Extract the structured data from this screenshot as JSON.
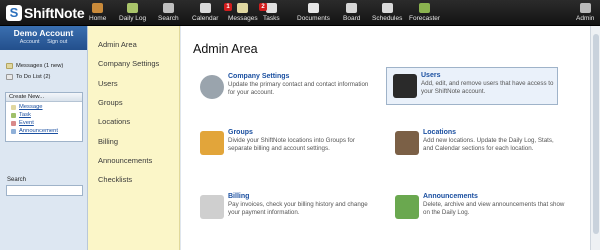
{
  "app": {
    "logo_text": "ShiftNote"
  },
  "topnav": [
    {
      "label": "Home",
      "icon": "home-icon",
      "color": "#c98a3a"
    },
    {
      "label": "Daily Log",
      "icon": "book-icon",
      "color": "#a9c46a"
    },
    {
      "label": "Search",
      "icon": "magnifier-icon",
      "color": "#bfbfbf"
    },
    {
      "label": "Calendar",
      "icon": "calendar-icon",
      "color": "#d9d9d9"
    },
    {
      "label": "Messages",
      "icon": "envelope-icon",
      "color": "#e0d7a0",
      "badge": "1"
    },
    {
      "label": "Tasks",
      "icon": "checklist-icon",
      "color": "#e0e0e0",
      "badge": "2"
    },
    {
      "label": "Documents",
      "icon": "folder-icon",
      "color": "#e6e6e6"
    },
    {
      "label": "Board",
      "icon": "board-icon",
      "color": "#d6d6d6"
    },
    {
      "label": "Schedules",
      "icon": "schedule-icon",
      "color": "#d9d9d9"
    },
    {
      "label": "Forecaster",
      "icon": "chart-icon",
      "color": "#8bb34f"
    },
    {
      "label": "Admin",
      "icon": "admin-icon",
      "color": "#b9b9b9"
    }
  ],
  "account": {
    "name": "Demo Account",
    "account_link": "Account",
    "signout_link": "Sign out"
  },
  "sidebar": {
    "messages": "Messages (1 new)",
    "todo": "To Do List (2)",
    "create_header": "Create New...",
    "create_items": [
      "Message",
      "Task",
      "Event",
      "Announcement"
    ],
    "search_label": "Search"
  },
  "settings_nav": [
    "Admin Area",
    "Company Settings",
    "Users",
    "Groups",
    "Locations",
    "Billing",
    "Announcements",
    "Checklists"
  ],
  "main": {
    "title": "Admin Area",
    "tiles": [
      {
        "title": "Company Settings",
        "desc": "Update the primary contact and contact information for your account.",
        "icon": "gear-icon",
        "selected": false
      },
      {
        "title": "Users",
        "desc": "Add, edit, and remove users that have access to your ShiftNote account.",
        "icon": "user-icon",
        "selected": true
      },
      {
        "title": "Groups",
        "desc": "Divide your ShiftNote locations into Groups for separate billing and account settings.",
        "icon": "folder-users-icon",
        "selected": false
      },
      {
        "title": "Locations",
        "desc": "Add new locations. Update the Daily Log, Stats, and Calendar sections for each location.",
        "icon": "house-icon",
        "selected": false
      },
      {
        "title": "Billing",
        "desc": "Pay invoices, check your billing history and change your payment information.",
        "icon": "calculator-icon",
        "selected": false
      },
      {
        "title": "Announcements",
        "desc": "Delete, archive and view announcements that show on the Daily Log.",
        "icon": "speech-bubble-icon",
        "selected": false
      }
    ]
  },
  "colors": {
    "accent": "#1a4fa0",
    "nav_bg": "#fbf6c8",
    "sidebar_bg": "#dde7f2",
    "header_bg": "#1c1c1c",
    "badge": "#d21d1d"
  }
}
